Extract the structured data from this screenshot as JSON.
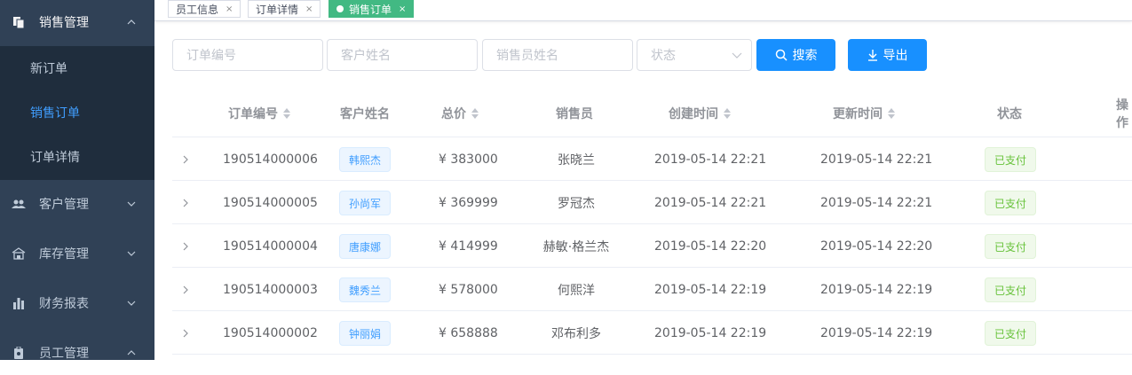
{
  "sidebar": {
    "sales": {
      "label": "销售管理",
      "icon": "documents-icon"
    },
    "sub_items": [
      {
        "label": "新订单"
      },
      {
        "label": "销售订单"
      },
      {
        "label": "订单详情"
      }
    ],
    "customer": {
      "label": "客户管理",
      "icon": "users-icon"
    },
    "inventory": {
      "label": "库存管理",
      "icon": "warehouse-icon"
    },
    "finance": {
      "label": "财务报表",
      "icon": "bar-chart-icon"
    },
    "staff": {
      "label": "员工管理",
      "icon": "badge-icon"
    }
  },
  "tags": [
    {
      "label": "员工信息",
      "close": "×"
    },
    {
      "label": "订单详情",
      "close": "×"
    },
    {
      "label": "销售订单",
      "close": "×"
    }
  ],
  "filters": {
    "order_no_placeholder": "订单编号",
    "customer_placeholder": "客户姓名",
    "salesperson_placeholder": "销售员姓名",
    "status_placeholder": "状态",
    "search_label": "搜索",
    "export_label": "导出"
  },
  "table": {
    "headers": {
      "order_no": "订单编号",
      "customer": "客户姓名",
      "total": "总价",
      "salesperson": "销售员",
      "created": "创建时间",
      "updated": "更新时间",
      "status": "状态",
      "actions": "操作"
    },
    "rows": [
      {
        "order_no": "190514000006",
        "customer": "韩熙杰",
        "total": "¥ 383000",
        "salesperson": "张晓兰",
        "created": "2019-05-14 22:21",
        "updated": "2019-05-14 22:21",
        "status": "已支付"
      },
      {
        "order_no": "190514000005",
        "customer": "孙尚军",
        "total": "¥ 369999",
        "salesperson": "罗冠杰",
        "created": "2019-05-14 22:21",
        "updated": "2019-05-14 22:21",
        "status": "已支付"
      },
      {
        "order_no": "190514000004",
        "customer": "唐康娜",
        "total": "¥ 414999",
        "salesperson": "赫敏·格兰杰",
        "created": "2019-05-14 22:20",
        "updated": "2019-05-14 22:20",
        "status": "已支付"
      },
      {
        "order_no": "190514000003",
        "customer": "魏秀兰",
        "total": "¥ 578000",
        "salesperson": "何熙洋",
        "created": "2019-05-14 22:19",
        "updated": "2019-05-14 22:19",
        "status": "已支付"
      },
      {
        "order_no": "190514000002",
        "customer": "钟丽娟",
        "total": "¥ 658888",
        "salesperson": "邓布利多",
        "created": "2019-05-14 22:19",
        "updated": "2019-05-14 22:19",
        "status": "已支付"
      }
    ]
  },
  "colors": {
    "sidebar_bg": "#304156",
    "submenu_bg": "#1f2d3d",
    "primary": "#1890ff",
    "active_tag": "#42b983",
    "active_menu": "#409eff"
  }
}
